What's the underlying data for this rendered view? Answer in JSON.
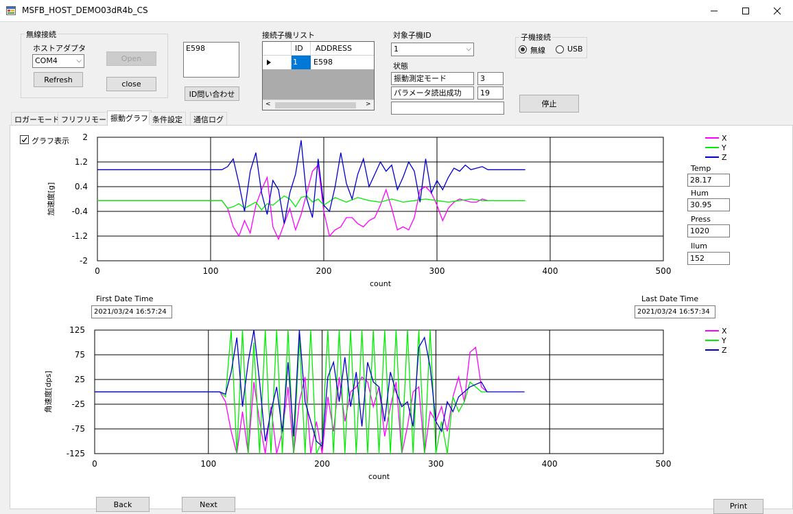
{
  "window": {
    "title": "MSFB_HOST_DEMO03dR4b_CS",
    "icon": "app-window-icon",
    "controls": [
      "minimize",
      "maximize",
      "close"
    ]
  },
  "wireless": {
    "group_title": "無線接続",
    "adapter_label": "ホストアダプタ",
    "adapter_value": "COM4",
    "refresh_label": "Refresh",
    "open_label": "Open",
    "close_label": "close"
  },
  "id_box": {
    "value": "E598",
    "query_label": "ID問い合わせ"
  },
  "child_list": {
    "title": "接続子機リスト",
    "columns": [
      "ID",
      "ADDRESS"
    ],
    "rows": [
      {
        "id": "1",
        "address": "E598"
      }
    ]
  },
  "target": {
    "title": "対象子機ID",
    "value": "1",
    "status_label": "状態",
    "status_rows": [
      {
        "label": "振動測定モード",
        "value": "3"
      },
      {
        "label": "パラメータ読出成功",
        "value": "19"
      }
    ],
    "extra_value": ""
  },
  "child_conn": {
    "title": "子機接続",
    "options": [
      "無線",
      "USB"
    ],
    "selected": "無線",
    "stop_label": "停止"
  },
  "tabs": [
    "ロガーモード",
    "フリフリモード",
    "振動グラフ",
    "条件設定",
    "通信ログ"
  ],
  "active_tab": "振動グラフ",
  "graph": {
    "show_label": "グラフ表示",
    "show_checked": true,
    "first_date_label": "First Date Time",
    "first_date_value": "2021/03/24  16:57:24",
    "last_date_label": "Last Date Time",
    "last_date_value": "2021/03/24  16:57:34",
    "back_label": "Back",
    "next_label": "Next",
    "print_label": "Print"
  },
  "sensors": [
    {
      "label": "Temp",
      "value": "28.17"
    },
    {
      "label": "Hum",
      "value": "30.95"
    },
    {
      "label": "Press",
      "value": "1020"
    },
    {
      "label": "Ilum",
      "value": "152"
    }
  ],
  "colors": {
    "X": "#ff00ff",
    "Y": "#00ee00",
    "Z": "#0000cc"
  },
  "chart_data": [
    {
      "type": "line",
      "ylabel": "加速度[g]",
      "xlabel": "count",
      "xlim": [
        0,
        500
      ],
      "ylim": [
        -2,
        2
      ],
      "xticks": [
        0,
        100,
        200,
        300,
        400,
        500
      ],
      "yticks": [
        2,
        1.2,
        0.4,
        -0.4,
        -1.2,
        -2
      ],
      "ytick_labels": [
        "2",
        "1.2",
        "0.4",
        "-0.4",
        "-1.2",
        "-2"
      ],
      "legend": [
        "X",
        "Y",
        "Z"
      ],
      "series": [
        {
          "name": "X",
          "x": [
            0,
            110,
            115,
            120,
            125,
            130,
            135,
            140,
            145,
            150,
            155,
            160,
            165,
            170,
            175,
            180,
            185,
            190,
            195,
            200,
            205,
            210,
            215,
            220,
            225,
            230,
            235,
            240,
            245,
            250,
            255,
            260,
            265,
            270,
            275,
            280,
            285,
            290,
            295,
            300,
            305,
            310,
            315,
            320,
            325,
            330,
            335,
            340,
            345
          ],
          "y": [
            -0.05,
            -0.05,
            -0.3,
            -0.9,
            -1.2,
            -0.7,
            -1.1,
            -0.2,
            0.3,
            0.7,
            -0.9,
            -1.3,
            -0.8,
            -0.3,
            -1.0,
            -0.5,
            0.2,
            0.9,
            1.1,
            -0.4,
            -1.2,
            -1.0,
            -0.9,
            -0.6,
            -0.6,
            -0.8,
            -0.9,
            -0.7,
            -0.6,
            -0.2,
            0.3,
            -0.3,
            -1.0,
            -0.9,
            -1.0,
            -0.6,
            0.3,
            0.4,
            0.2,
            -0.2,
            -0.7,
            -0.3,
            -0.1,
            0.0,
            -0.05,
            -0.1,
            -0.1,
            0.0,
            -0.05
          ]
        },
        {
          "name": "Y",
          "x": [
            0,
            110,
            115,
            120,
            125,
            130,
            135,
            140,
            145,
            150,
            155,
            160,
            165,
            170,
            175,
            180,
            185,
            190,
            195,
            200,
            210,
            220,
            230,
            240,
            250,
            260,
            270,
            280,
            290,
            300,
            310,
            320,
            330,
            340,
            350,
            378
          ],
          "y": [
            -0.05,
            -0.05,
            -0.3,
            -0.25,
            -0.15,
            -0.3,
            -0.2,
            -0.1,
            -0.35,
            -0.15,
            -0.2,
            -0.05,
            0.1,
            0.0,
            -0.25,
            0.05,
            0.1,
            -0.1,
            0.0,
            -0.2,
            0.05,
            -0.1,
            0.05,
            -0.05,
            -0.1,
            0.0,
            -0.1,
            -0.05,
            0.0,
            -0.05,
            -0.1,
            -0.05,
            0.0,
            -0.05,
            -0.05,
            -0.05
          ]
        },
        {
          "name": "Z",
          "x": [
            0,
            110,
            115,
            120,
            125,
            130,
            135,
            140,
            145,
            150,
            155,
            160,
            165,
            170,
            175,
            180,
            185,
            190,
            195,
            200,
            205,
            210,
            215,
            220,
            225,
            230,
            235,
            240,
            245,
            250,
            255,
            260,
            265,
            270,
            275,
            280,
            285,
            290,
            295,
            300,
            305,
            310,
            315,
            320,
            325,
            330,
            335,
            340,
            345,
            350,
            378
          ],
          "y": [
            0.95,
            0.95,
            1.05,
            1.3,
            0.5,
            -0.4,
            0.9,
            1.5,
            0.2,
            -0.5,
            0.6,
            0.3,
            -0.8,
            0.2,
            0.8,
            1.9,
            0.0,
            -0.6,
            1.3,
            -0.2,
            -0.4,
            0.4,
            1.5,
            0.5,
            0.0,
            0.8,
            1.3,
            0.4,
            0.8,
            1.2,
            0.9,
            1.1,
            0.3,
            0.7,
            1.2,
            0.9,
            -0.1,
            1.3,
            0.2,
            0.6,
            0.3,
            0.7,
            1.0,
            0.9,
            1.1,
            0.95,
            1.0,
            1.05,
            0.95,
            0.95,
            0.95
          ]
        }
      ]
    },
    {
      "type": "line",
      "ylabel": "角速度[dps]",
      "xlabel": "count",
      "xlim": [
        0,
        500
      ],
      "ylim": [
        -125,
        125
      ],
      "xticks": [
        0,
        100,
        200,
        300,
        400,
        500
      ],
      "yticks": [
        125,
        75,
        25,
        -25,
        -75,
        -125
      ],
      "legend": [
        "X",
        "Y",
        "Z"
      ],
      "series": [
        {
          "name": "X",
          "x": [
            0,
            110,
            115,
            120,
            125,
            130,
            135,
            140,
            145,
            150,
            155,
            160,
            165,
            170,
            175,
            180,
            185,
            190,
            195,
            200,
            205,
            210,
            215,
            220,
            225,
            230,
            235,
            240,
            245,
            250,
            255,
            260,
            265,
            270,
            275,
            280,
            285,
            290,
            295,
            300,
            305,
            310,
            315,
            320,
            325,
            330,
            335,
            340,
            345
          ],
          "y": [
            0,
            0,
            -20,
            -80,
            -125,
            -40,
            -125,
            20,
            -60,
            -125,
            -30,
            -125,
            -80,
            10,
            -125,
            -20,
            30,
            -125,
            -60,
            -125,
            -10,
            -80,
            30,
            -60,
            0,
            10,
            30,
            20,
            -30,
            10,
            -90,
            -30,
            20,
            -125,
            -70,
            0,
            10,
            -125,
            -40,
            -60,
            -30,
            -80,
            -10,
            30,
            -20,
            80,
            90,
            10,
            0
          ]
        },
        {
          "name": "Y",
          "x": [
            0,
            110,
            115,
            120,
            125,
            130,
            135,
            140,
            145,
            150,
            155,
            160,
            165,
            170,
            175,
            180,
            185,
            190,
            195,
            200,
            205,
            210,
            215,
            220,
            225,
            230,
            235,
            240,
            245,
            250,
            255,
            260,
            265,
            270,
            275,
            280,
            285,
            290,
            295,
            300,
            305,
            310,
            315,
            320,
            325,
            330,
            335,
            340,
            345
          ],
          "y": [
            0,
            0,
            -10,
            125,
            -125,
            125,
            -125,
            100,
            -125,
            125,
            -125,
            125,
            -125,
            125,
            -125,
            110,
            -125,
            125,
            -125,
            -100,
            125,
            -125,
            125,
            -125,
            125,
            -125,
            125,
            -125,
            125,
            -125,
            125,
            -125,
            125,
            -125,
            125,
            -125,
            125,
            -125,
            125,
            -125,
            -60,
            -125,
            -10,
            -40,
            -20,
            20,
            10,
            0,
            0
          ]
        },
        {
          "name": "Z",
          "x": [
            0,
            110,
            115,
            120,
            125,
            130,
            135,
            140,
            145,
            150,
            155,
            160,
            165,
            170,
            175,
            180,
            185,
            190,
            195,
            200,
            205,
            210,
            215,
            220,
            225,
            230,
            235,
            240,
            245,
            250,
            255,
            260,
            265,
            270,
            275,
            280,
            285,
            290,
            295,
            300,
            305,
            310,
            315,
            320,
            325,
            330,
            335,
            340,
            345,
            350,
            378
          ],
          "y": [
            0,
            0,
            -5,
            40,
            110,
            -30,
            60,
            125,
            20,
            -100,
            -40,
            10,
            -80,
            60,
            -90,
            125,
            -20,
            -60,
            -100,
            -110,
            30,
            60,
            -20,
            70,
            -30,
            40,
            -70,
            60,
            20,
            10,
            -60,
            40,
            0,
            -30,
            -20,
            -70,
            90,
            110,
            50,
            -60,
            -80,
            -20,
            -40,
            -10,
            0,
            10,
            15,
            20,
            0,
            0,
            0
          ]
        }
      ]
    }
  ]
}
